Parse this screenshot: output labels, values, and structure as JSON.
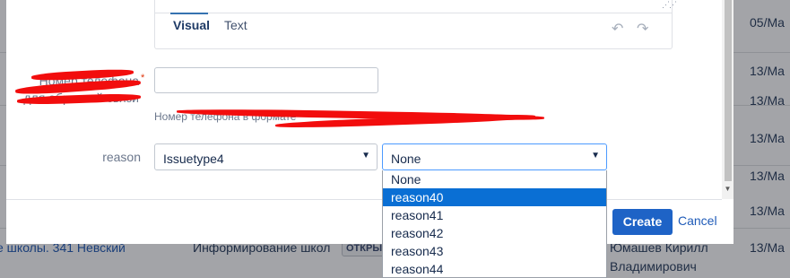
{
  "background": {
    "dates": [
      "05/Ma",
      "13/Ma",
      "13/Ma",
      "13/Ma",
      "13/Ma",
      "13/Ma",
      "13/Ma"
    ],
    "bottom_row": {
      "link": "е школы. 341 Невский",
      "summary": "Информирование школ",
      "status": "ОТКРЫ",
      "assignee_line1": "Юмашев Кирилл",
      "assignee_line2": "Владимирович"
    }
  },
  "editor": {
    "tab_visual": "Visual",
    "tab_text": "Text",
    "undo_icon": "↶",
    "redo_icon": "↷"
  },
  "phone_field": {
    "label_line1": "Номер телефона",
    "label_line2": "для обратной связи",
    "required_mark": "*",
    "value": "",
    "hint": "Номер телефона в формате"
  },
  "reason_field": {
    "label": "reason",
    "issuetype_value": "Issuetype4",
    "reason_value": "None",
    "arrow": "▼",
    "options": [
      {
        "label": "None",
        "selected": false
      },
      {
        "label": "reason40",
        "selected": true
      },
      {
        "label": "reason41",
        "selected": false
      },
      {
        "label": "reason42",
        "selected": false
      },
      {
        "label": "reason43",
        "selected": false
      },
      {
        "label": "reason44",
        "selected": false
      }
    ]
  },
  "footer": {
    "create_label": "Create",
    "cancel_label": "Cancel"
  },
  "colors": {
    "accent": "#1e63c6",
    "selected_option": "#0a6fd4",
    "redaction": "#f20d0d"
  }
}
